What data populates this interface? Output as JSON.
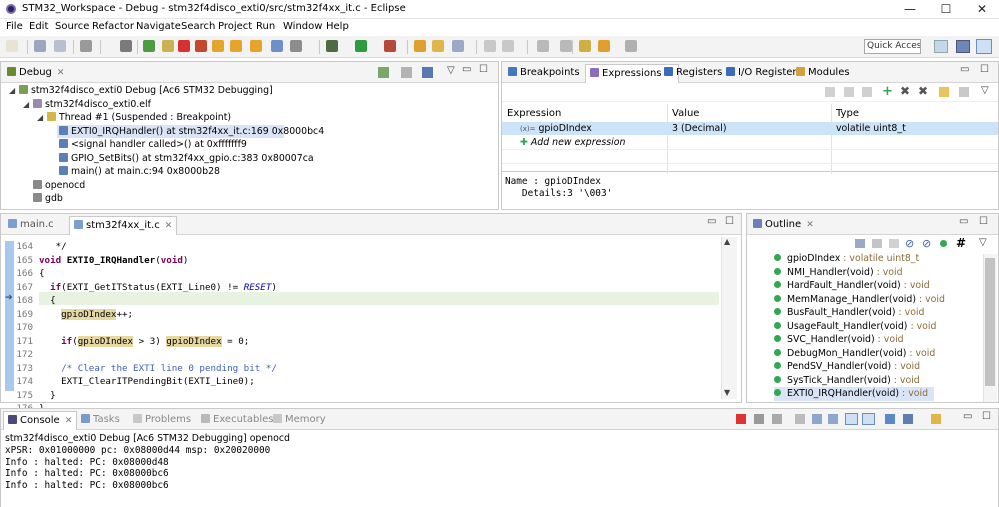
{
  "window": {
    "title": "STM32_Workspace - Debug - stm32f4disco_exti0/src/stm32f4xx_it.c - Eclipse",
    "minimize": "—",
    "maximize": "☐",
    "close": "✕"
  },
  "menu": [
    "File",
    "Edit",
    "Source",
    "Refactor",
    "Navigate",
    "Search",
    "Project",
    "Run",
    "Window",
    "Help"
  ],
  "quick_access": "Quick Access",
  "debug": {
    "tab": "Debug",
    "tree": [
      {
        "label": "stm32f4disco_exti0 Debug [Ac6 STM32 Debugging]",
        "level": 0
      },
      {
        "label": "stm32f4disco_exti0.elf",
        "level": 1
      },
      {
        "label": "Thread #1 (Suspended : Breakpoint)",
        "level": 2
      },
      {
        "label": "EXTI0_IRQHandler() at stm32f4xx_it.c:169 0x8000bc4",
        "level": 3,
        "selected": true
      },
      {
        "label": "<signal handler called>() at 0xfffffff9",
        "level": 3
      },
      {
        "label": "GPIO_SetBits() at stm32f4xx_gpio.c:383 0x80007ca",
        "level": 3
      },
      {
        "label": "main() at main.c:94 0x8000b28",
        "level": 3
      },
      {
        "label": "openocd",
        "level": 1
      },
      {
        "label": "gdb",
        "level": 1
      }
    ]
  },
  "expressions": {
    "tabs": [
      "Breakpoints",
      "Expressions",
      "Registers",
      "I/O Registers",
      "Modules"
    ],
    "headers": [
      "Expression",
      "Value",
      "Type"
    ],
    "rows": [
      {
        "expr": "gpioDIndex",
        "value": "3 (Decimal)",
        "type": "volatile uint8_t"
      }
    ],
    "add": "Add new expression",
    "detail_line1": "Name : gpioDIndex",
    "detail_line2": "   Details:3 '\\003'"
  },
  "editor": {
    "tabs": [
      "main.c",
      "stm32f4xx_it.c"
    ],
    "lines": [
      {
        "n": "164",
        "t": "   */"
      },
      {
        "n": "165",
        "t": "void EXTI0_IRQHandler(void)"
      },
      {
        "n": "166",
        "t": "{"
      },
      {
        "n": "167",
        "t": "  if(EXTI_GetITStatus(EXTI_Line0) != RESET)"
      },
      {
        "n": "168",
        "t": "  {"
      },
      {
        "n": "169",
        "t": "    gpioDIndex++;"
      },
      {
        "n": "170",
        "t": ""
      },
      {
        "n": "171",
        "t": "    if(gpioDIndex > 3) gpioDIndex = 0;"
      },
      {
        "n": "172",
        "t": ""
      },
      {
        "n": "173",
        "t": "    /* Clear the EXTI line 0 pending bit */"
      },
      {
        "n": "174",
        "t": "    EXTI_ClearITPendingBit(EXTI_Line0);"
      },
      {
        "n": "175",
        "t": "  }"
      },
      {
        "n": "176",
        "t": "}"
      },
      {
        "n": "177",
        "t": ""
      }
    ]
  },
  "outline": {
    "tab": "Outline",
    "items": [
      {
        "name": "gpioDIndex",
        "type": "volatile uint8_t"
      },
      {
        "name": "NMI_Handler(void)",
        "type": "void"
      },
      {
        "name": "HardFault_Handler(void)",
        "type": "void"
      },
      {
        "name": "MemManage_Handler(void)",
        "type": "void"
      },
      {
        "name": "BusFault_Handler(void)",
        "type": "void"
      },
      {
        "name": "UsageFault_Handler(void)",
        "type": "void"
      },
      {
        "name": "SVC_Handler(void)",
        "type": "void"
      },
      {
        "name": "DebugMon_Handler(void)",
        "type": "void"
      },
      {
        "name": "PendSV_Handler(void)",
        "type": "void"
      },
      {
        "name": "SysTick_Handler(void)",
        "type": "void"
      },
      {
        "name": "EXTI0_IRQHandler(void)",
        "type": "void",
        "selected": true
      }
    ]
  },
  "console": {
    "tabs": [
      "Console",
      "Tasks",
      "Problems",
      "Executables",
      "Memory"
    ],
    "header": "stm32f4disco_exti0 Debug [Ac6 STM32 Debugging] openocd",
    "lines": [
      "xPSR: 0x01000000 pc: 0x08000d44 msp: 0x20020000",
      "Info : halted: PC: 0x08000d48",
      "Info : halted: PC: 0x08000bc6",
      "Info : halted: PC: 0x08000bc6"
    ]
  }
}
